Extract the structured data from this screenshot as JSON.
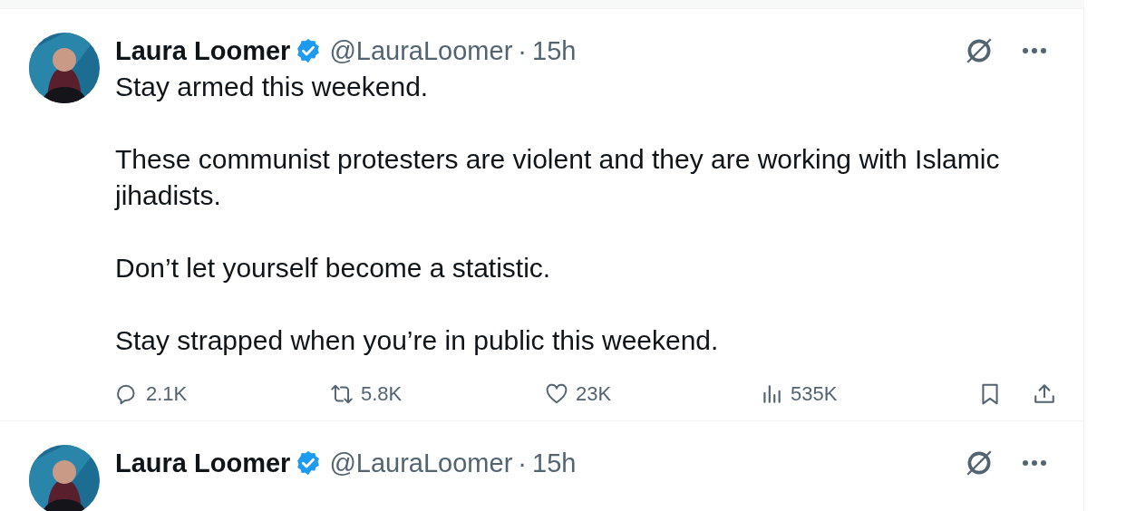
{
  "posts": [
    {
      "author": "Laura Loomer",
      "verified": true,
      "handle": "@LauraLoomer",
      "separator": "·",
      "time": "15h",
      "paragraphs": [
        "Stay armed this weekend.",
        "These communist protesters are violent and they are working with Islamic jihadists.",
        "Don’t let yourself become a statistic.",
        "Stay strapped when you’re in public this weekend."
      ],
      "stats": [
        {
          "kind": "reply",
          "count": "2.1K"
        },
        {
          "kind": "repost",
          "count": "5.8K"
        },
        {
          "kind": "like",
          "count": "23K"
        },
        {
          "kind": "views",
          "count": "535K"
        }
      ]
    },
    {
      "author": "Laura Loomer",
      "verified": true,
      "handle": "@LauraLoomer",
      "separator": "·",
      "time": "15h"
    }
  ]
}
